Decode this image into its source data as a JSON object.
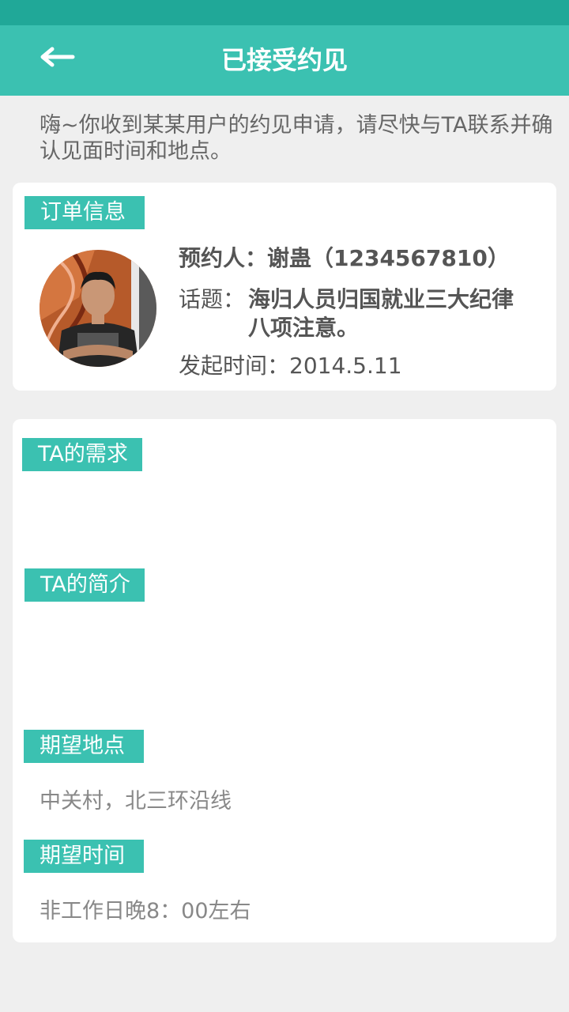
{
  "header": {
    "title": "已接受约见",
    "back_icon": "arrow-left-icon"
  },
  "intro": "嗨~你收到某某用户的约见申请，请尽快与TA联系并确认见面时间和地点。",
  "order": {
    "section_label": "订单信息",
    "booker": "预约人：谢蛊（1234567810）",
    "topic_label": "话题：",
    "topic": "海归人员归国就业三大纪律八项注意。",
    "start_time": "发起时间：2014.5.11"
  },
  "details": {
    "needs_label": "TA的需求",
    "needs": "",
    "profile_label": "TA的简介",
    "profile": "",
    "location_label": "期望地点",
    "location": "中关村，北三环沿线",
    "time_label": "期望时间",
    "time": "非工作日晚8：00左右"
  },
  "colors": {
    "status_bar": "#20a898",
    "accent": "#3bc1b1",
    "background": "#efefef"
  }
}
